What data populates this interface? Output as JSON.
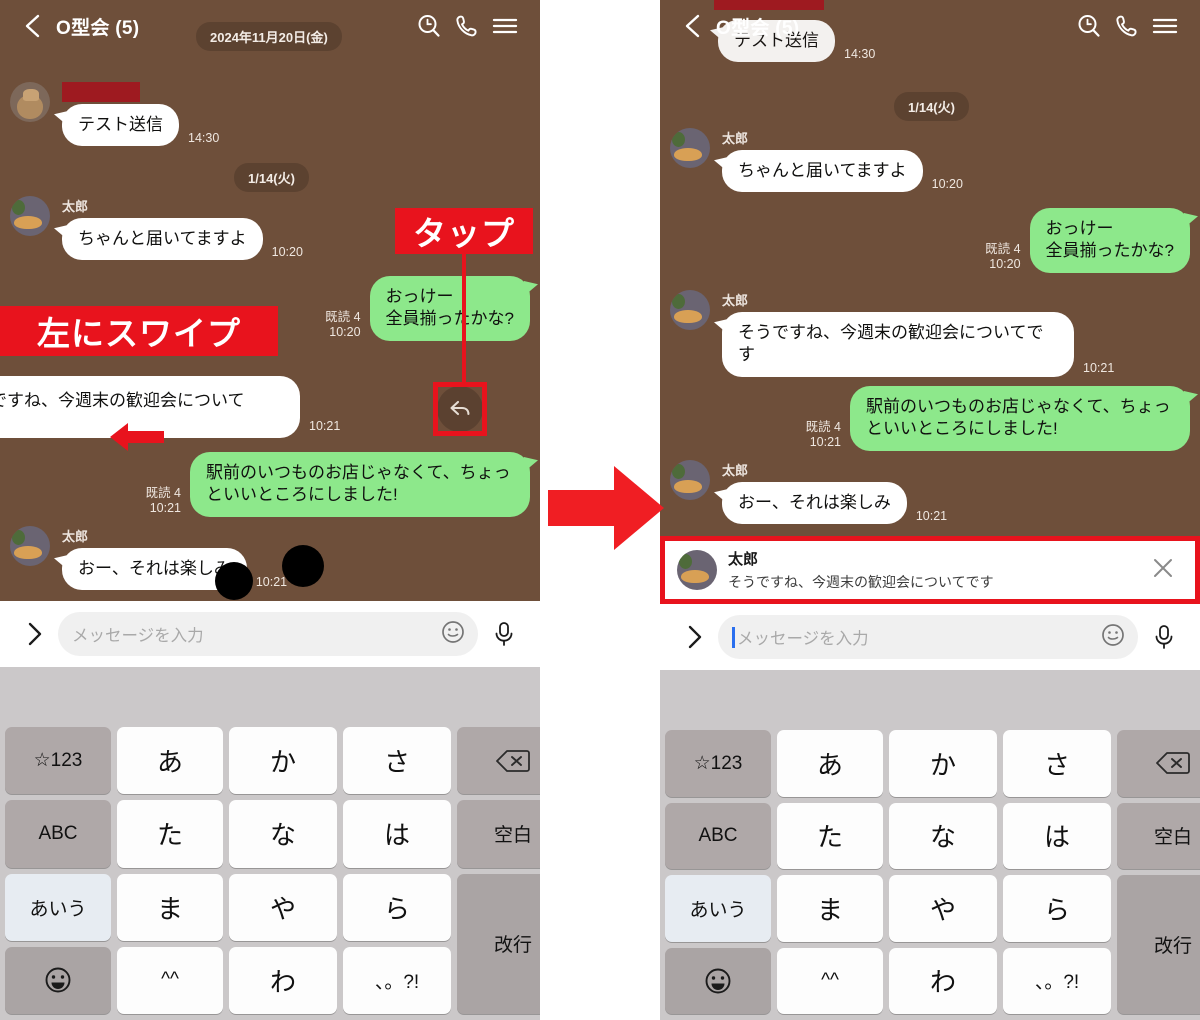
{
  "colors": {
    "chat_bg": "#6E4F3A",
    "bubble_in": "#FFFFFF",
    "bubble_out": "#8DE88B",
    "annotation_red": "#E8131D",
    "redaction": "#9E1A20",
    "keyboard_bg": "#CBC8C9",
    "caret": "#2A6FEF"
  },
  "header": {
    "title": "O型会 (5)",
    "back_icon": "chevron-left-icon",
    "search_icon": "search-clock-icon",
    "call_icon": "phone-icon",
    "menu_icon": "hamburger-menu-icon"
  },
  "left_panel": {
    "date_chip_top": "2024年11月20日(金)",
    "date_chip": "1/14(火)",
    "messages": [
      {
        "side": "in",
        "sender": "",
        "text": "テスト送信",
        "time": "14:30",
        "read": ""
      },
      {
        "side": "in",
        "sender": "太郎",
        "text": "ちゃんと届いてますよ",
        "time": "10:20",
        "read": ""
      },
      {
        "side": "out",
        "sender": "",
        "text": "おっけー\n全員揃ったかな?",
        "time": "10:20",
        "read": "既読 4"
      },
      {
        "side": "in",
        "sender": "",
        "text": "ですね、今週末の歓迎会について",
        "time": "10:21",
        "read": ""
      },
      {
        "side": "out",
        "sender": "",
        "text": "駅前のいつものお店じゃなくて、ちょっといいところにしました!",
        "time": "10:21",
        "read": "既読 4"
      },
      {
        "side": "in",
        "sender": "太郎",
        "text": "おー、それは楽しみ",
        "time": "10:21",
        "read": ""
      }
    ],
    "annotations": {
      "tap": "タップ",
      "swipe": "左にスワイプ"
    },
    "reply_button_icon": "reply-arrow-icon",
    "swipe_arrow_icon": "arrow-left-icon"
  },
  "transition": {
    "icon": "arrow-right-icon"
  },
  "right_panel": {
    "date_chip": "1/14(火)",
    "messages": [
      {
        "side": "in",
        "sender": "",
        "text": "テスト送信",
        "time": "14:30",
        "read": ""
      },
      {
        "side": "in",
        "sender": "太郎",
        "text": "ちゃんと届いてますよ",
        "time": "10:20",
        "read": ""
      },
      {
        "side": "out",
        "sender": "",
        "text": "おっけー\n全員揃ったかな?",
        "time": "10:20",
        "read": "既読 4"
      },
      {
        "side": "in",
        "sender": "太郎",
        "text": "そうですね、今週末の歓迎会についてです",
        "time": "10:21",
        "read": ""
      },
      {
        "side": "out",
        "sender": "",
        "text": "駅前のいつものお店じゃなくて、ちょっといいところにしました!",
        "time": "10:21",
        "read": "既読 4"
      },
      {
        "side": "in",
        "sender": "太郎",
        "text": "おー、それは楽しみ",
        "time": "10:21",
        "read": ""
      }
    ],
    "reply_preview": {
      "name": "太郎",
      "text": "そうですね、今週末の歓迎会についてです",
      "close_icon": "close-icon"
    }
  },
  "input_bar": {
    "expand_icon": "chevron-right-icon",
    "placeholder": "メッセージを入力",
    "emoji_icon": "smiley-icon",
    "mic_icon": "microphone-icon"
  },
  "keyboard": {
    "rows": [
      [
        {
          "label": "☆123",
          "style": "g"
        },
        {
          "label": "あ",
          "style": "w"
        },
        {
          "label": "か",
          "style": "w"
        },
        {
          "label": "さ",
          "style": "w"
        },
        {
          "label": "delete-icon",
          "style": "g"
        }
      ],
      [
        {
          "label": "ABC",
          "style": "g"
        },
        {
          "label": "た",
          "style": "w"
        },
        {
          "label": "な",
          "style": "w"
        },
        {
          "label": "は",
          "style": "w"
        },
        {
          "label": "空白",
          "style": "g"
        }
      ],
      [
        {
          "label": "あいう",
          "style": "lt"
        },
        {
          "label": "ま",
          "style": "w"
        },
        {
          "label": "や",
          "style": "w"
        },
        {
          "label": "ら",
          "style": "w"
        },
        {
          "label": "改行",
          "style": "g2"
        }
      ],
      [
        {
          "label": "emoji-icon",
          "style": "g2"
        },
        {
          "label": "^^",
          "style": "w"
        },
        {
          "label": "わ",
          "style": "w"
        },
        {
          "label": "、。?!",
          "style": "w"
        }
      ]
    ]
  }
}
